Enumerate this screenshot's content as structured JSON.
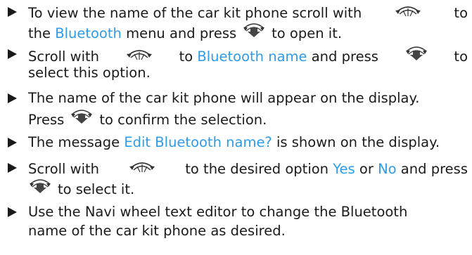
{
  "colors": {
    "text": "#1a1a1a",
    "highlight": "#2e9be8"
  },
  "icons": {
    "scroll": "navi-wheel-scroll-icon",
    "press": "navi-wheel-press-icon"
  },
  "steps": [
    {
      "lines": [
        {
          "a": "To view the name of the car kit phone scroll with",
          "b": "to"
        },
        {
          "a": "the ",
          "hl": "Bluetooth",
          "b": " menu and press",
          "c": "to open it."
        }
      ]
    },
    {
      "lines": [
        {
          "a": "Scroll with",
          "b": "to ",
          "hl": "Bluetooth name",
          "c": " and press",
          "d": "to"
        },
        {
          "a": "select this option."
        }
      ]
    },
    {
      "lines": [
        {
          "a": "The name of the car kit phone will appear on the display."
        },
        {
          "a": "Press",
          "b": "to confirm the selection."
        }
      ]
    },
    {
      "lines": [
        {
          "a": "The message ",
          "hl": "Edit Bluetooth name?",
          "b": " is shown on the display."
        }
      ]
    },
    {
      "lines": [
        {
          "a": "Scroll with",
          "b": "to the desired option ",
          "hl1": "Yes",
          "c": " or ",
          "hl2": "No",
          "d": " and press"
        },
        {
          "a": "to select it."
        }
      ]
    },
    {
      "lines": [
        {
          "a": "Use the Navi wheel text editor to change the Bluetooth"
        },
        {
          "a": "name of the car kit phone as desired."
        }
      ]
    }
  ]
}
